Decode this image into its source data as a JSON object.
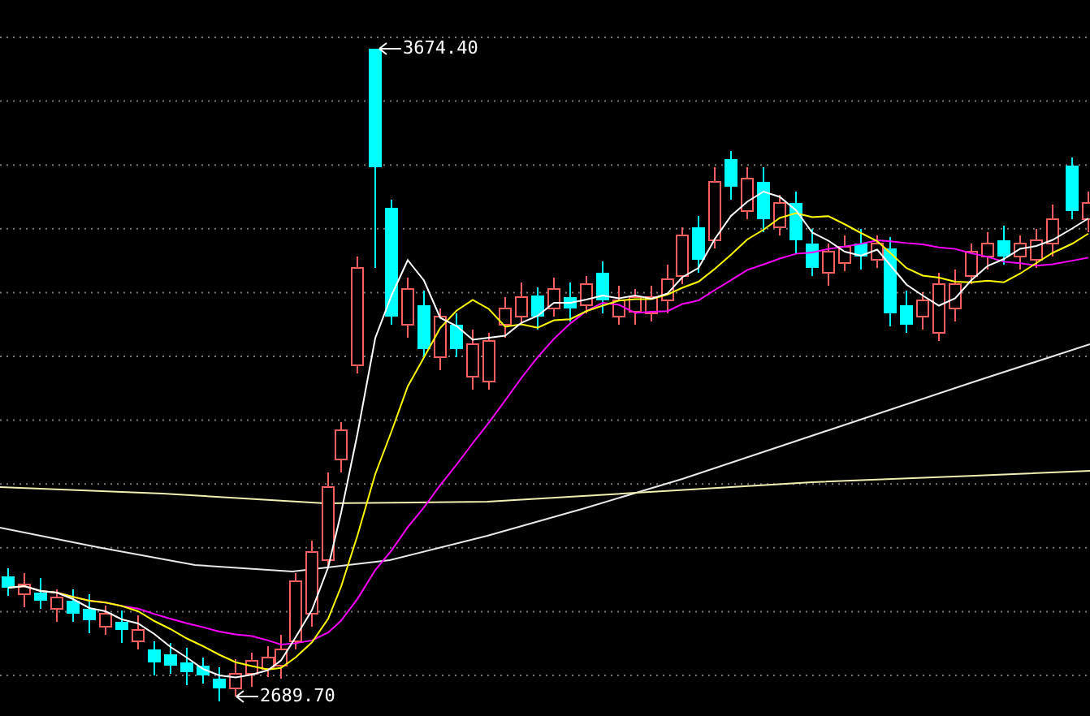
{
  "chart": {
    "high_label": "3674.40",
    "low_label": "2689.70"
  }
}
